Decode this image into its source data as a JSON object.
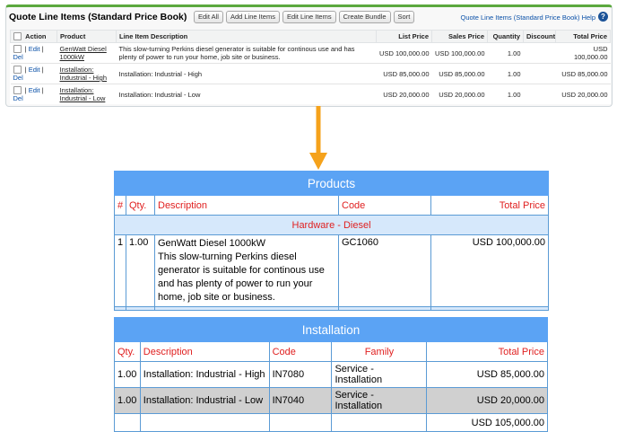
{
  "quote": {
    "title": "Quote Line Items (Standard Price Book)",
    "buttons": [
      "Edit All",
      "Add Line Items",
      "Edit Line Items",
      "Create Bundle",
      "Sort"
    ],
    "help_link": "Quote Line Items (Standard Price Book) Help",
    "help_icon": "?",
    "columns": [
      "Action",
      "Product",
      "Line Item Description",
      "List Price",
      "Sales Price",
      "Quantity",
      "Discount",
      "Total Price"
    ],
    "edit_label": "Edit",
    "del_label": "Del",
    "rows": [
      {
        "product": "GenWatt Diesel 1000kW",
        "description": "This slow-turning Perkins diesel generator is suitable for continous use and has plenty of power to run your home, job site or business.",
        "list_price": "USD 100,000.00",
        "sales_price": "USD 100,000.00",
        "quantity": "1.00",
        "discount": "",
        "total": "USD 100,000.00"
      },
      {
        "product": "Installation: Industrial - High",
        "description": "Installation: Industrial - High",
        "list_price": "USD 85,000.00",
        "sales_price": "USD 85,000.00",
        "quantity": "1.00",
        "discount": "",
        "total": "USD 85,000.00"
      },
      {
        "product": "Installation: Industrial - Low",
        "description": "Installation: Industrial - Low",
        "list_price": "USD 20,000.00",
        "sales_price": "USD 20,000.00",
        "quantity": "1.00",
        "discount": "",
        "total": "USD 20,000.00"
      }
    ]
  },
  "products": {
    "title": "Products",
    "columns": [
      "#",
      "Qty.",
      "Description",
      "Code",
      "Total Price"
    ],
    "group": "Hardware - Diesel",
    "rows": [
      {
        "num": "1",
        "qty": "1.00",
        "name": "GenWatt Diesel 1000kW",
        "description": "This slow-turning Perkins diesel generator is suitable for continous use and has plenty of power to run your home, job site or business.",
        "code": "GC1060",
        "total": "USD 100,000.00"
      }
    ]
  },
  "installation": {
    "title": "Installation",
    "columns": [
      "Qty.",
      "Description",
      "Code",
      "Family",
      "Total Price"
    ],
    "rows": [
      {
        "qty": "1.00",
        "description": "Installation: Industrial - High",
        "code": "IN7080",
        "family": "Service - Installation",
        "total": "USD 85,000.00"
      },
      {
        "qty": "1.00",
        "description": "Installation: Industrial - Low",
        "code": "IN7040",
        "family": "Service - Installation",
        "total": "USD 20,000.00"
      }
    ],
    "grand_total": "USD 105,000.00"
  },
  "colors": {
    "accent_blue": "#5ba3f4",
    "header_red": "#e02020",
    "arrow_orange": "#f5a21b",
    "panel_green": "#5ba83e"
  }
}
